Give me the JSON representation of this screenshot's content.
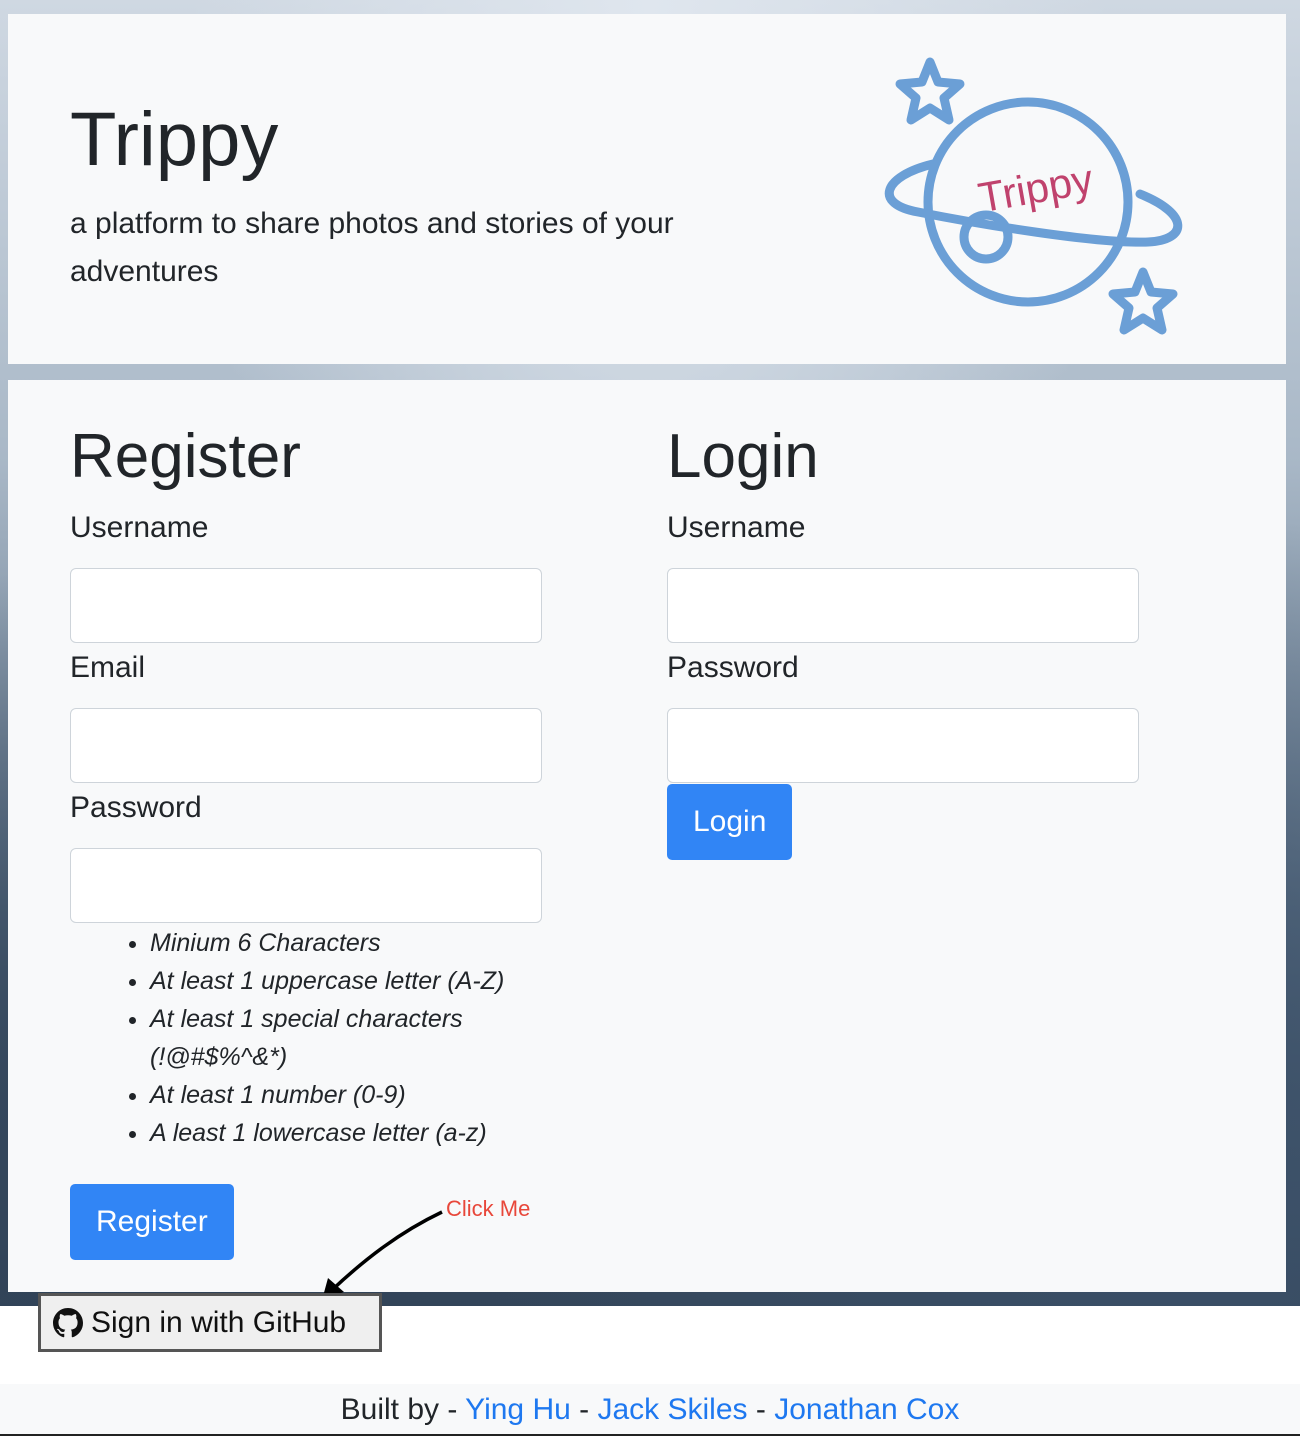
{
  "hero": {
    "title": "Trippy",
    "subtitle": "a platform to share photos and stories of your adventures",
    "logo_text": "Trippy"
  },
  "register": {
    "heading": "Register",
    "username_label": "Username",
    "username_value": "",
    "email_label": "Email",
    "email_value": "",
    "password_label": "Password",
    "password_value": "",
    "rules": [
      "Minium 6 Characters",
      "At least 1 uppercase letter (A-Z)",
      "At least 1 special characters (!@#$%^&*)",
      "At least 1 number (0-9)",
      "A least 1 lowercase letter (a-z)"
    ],
    "button_label": "Register"
  },
  "login": {
    "heading": "Login",
    "username_label": "Username",
    "username_value": "",
    "password_label": "Password",
    "password_value": "",
    "button_label": "Login"
  },
  "annotation": {
    "text": "Click Me",
    "color": "#e8473a"
  },
  "github": {
    "label": "Sign in with GitHub",
    "icon": "github-icon"
  },
  "footer": {
    "prefix": "Built by",
    "separator": "-",
    "authors": [
      "Ying Hu",
      "Jack Skiles",
      "Jonathan Cox"
    ]
  },
  "colors": {
    "primary": "#3185f5",
    "logo_blue": "#6b9fd6",
    "logo_text": "#c0426d",
    "link": "#1e78f0"
  }
}
